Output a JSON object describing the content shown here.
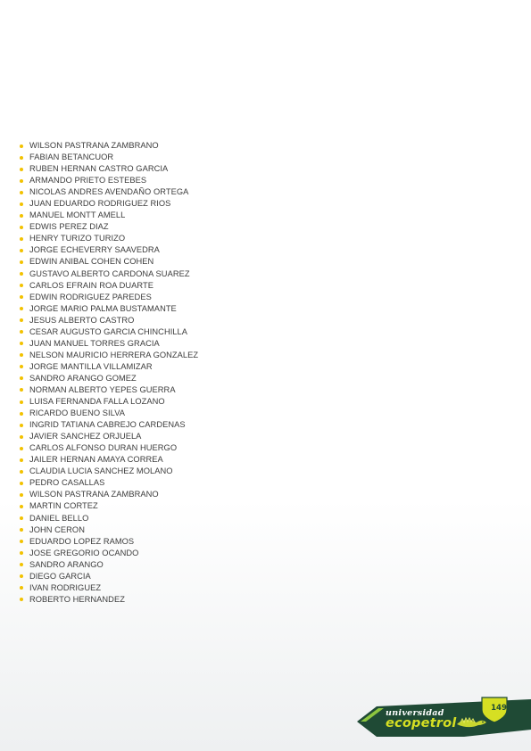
{
  "names": [
    "WILSON PASTRANA ZAMBRANO",
    "FABIAN BETANCUOR",
    "RUBEN HERNAN CASTRO GARCIA",
    "ARMANDO PRIETO ESTEBES",
    "NICOLAS ANDRES AVENDAÑO ORTEGA",
    "JUAN EDUARDO RODRIGUEZ RIOS",
    "MANUEL MONTT AMELL",
    "EDWIS PEREZ DIAZ",
    "HENRY TURIZO TURIZO",
    "JORGE ECHEVERRY SAAVEDRA",
    "EDWIN ANIBAL COHEN COHEN",
    "GUSTAVO ALBERTO CARDONA SUAREZ",
    "CARLOS EFRAIN ROA DUARTE",
    "EDWIN RODRIGUEZ PAREDES",
    "JORGE MARIO PALMA BUSTAMANTE",
    "JESUS ALBERTO CASTRO",
    "CESAR AUGUSTO GARCIA CHINCHILLA",
    "JUAN MANUEL TORRES GRACIA",
    "NELSON MAURICIO HERRERA GONZALEZ",
    "JORGE MANTILLA VILLAMIZAR",
    "SANDRO ARANGO GOMEZ",
    "NORMAN ALBERTO YEPES GUERRA",
    "LUISA FERNANDA FALLA LOZANO",
    "RICARDO BUENO SILVA",
    "INGRID TATIANA CABREJO CARDENAS",
    "JAVIER SANCHEZ ORJUELA",
    "CARLOS ALFONSO DURAN HUERGO",
    "JAILER HERNAN AMAYA CORREA",
    "CLAUDIA LUCIA SANCHEZ MOLANO",
    "PEDRO CASALLAS",
    "WILSON PASTRANA ZAMBRANO",
    "MARTIN CORTEZ",
    "DANIEL BELLO",
    "JOHN CERON",
    "EDUARDO LOPEZ RAMOS",
    "JOSE GREGORIO OCANDO",
    "SANDRO ARANGO",
    "DIEGO GARCIA",
    "IVAN RODRIGUEZ",
    "ROBERTO HERNANDEZ"
  ],
  "footer": {
    "brand_top": "universidad",
    "brand_main": "ecopetrol",
    "page_number": "149"
  },
  "colors": {
    "bullet": "#f2c200",
    "text": "#3c3c3c",
    "brand_dark_green": "#1f4a35",
    "brand_lime": "#d6df23"
  },
  "icons": {
    "mascot": "iguana-icon",
    "page_badge": "shield-badge-icon"
  }
}
